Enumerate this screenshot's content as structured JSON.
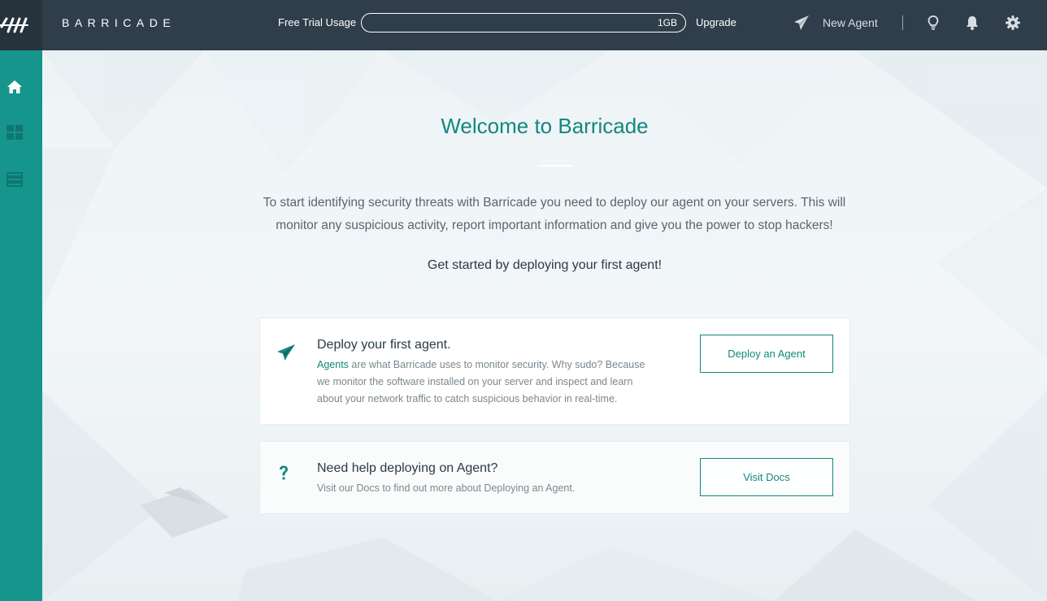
{
  "app": {
    "brand": "BARRICADE"
  },
  "topbar": {
    "trial_label": "Free Trial Usage",
    "trial_value": "1GB",
    "upgrade_label": "Upgrade",
    "new_agent_label": "New Agent"
  },
  "sidebar": {
    "items": [
      {
        "icon": "home-icon"
      },
      {
        "icon": "dashboard-grid-icon"
      },
      {
        "icon": "server-list-icon"
      }
    ]
  },
  "main": {
    "title": "Welcome to Barricade",
    "intro": "To start identifying security threats with Barricade you need to deploy our agent on your servers. This will monitor any suspicious activity, report important information and give you the power to stop hackers!",
    "get_started": "Get started by deploying your first agent!",
    "cards": [
      {
        "icon": "paper-plane-icon",
        "title": "Deploy your first agent.",
        "link_text": "Agents",
        "text": " are what Barricade uses to monitor security. Why sudo? Because we monitor the software installed on your server and inspect and learn about your network traffic to catch suspicious behavior in real-time.",
        "button": "Deploy an Agent"
      },
      {
        "icon": "question-icon",
        "title": "Need help deploying on Agent?",
        "text": "Visit our Docs to find out more about Deploying an Agent.",
        "button": "Visit Docs"
      }
    ]
  },
  "colors": {
    "accent": "#13877f",
    "sidebar": "#15958c",
    "topbar": "#2f3e4a"
  }
}
